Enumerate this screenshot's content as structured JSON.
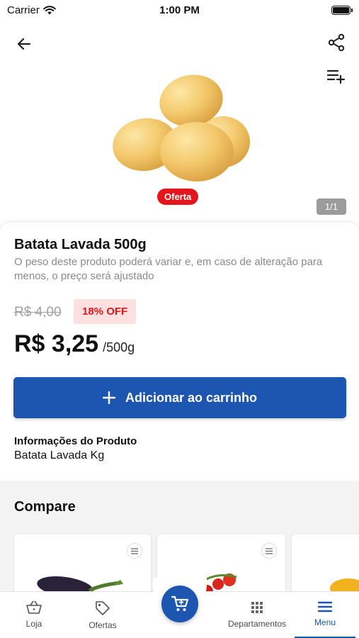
{
  "status_bar": {
    "carrier": "Carrier",
    "time": "1:00 PM"
  },
  "header": {
    "back_icon": "arrow-left-icon",
    "share_icon": "share-icon",
    "add_to_list_icon": "playlist-add-icon"
  },
  "image_gallery": {
    "offer_badge": "Oferta",
    "counter": "1/1"
  },
  "product": {
    "title": "Batata Lavada 500g",
    "note": "O peso deste produto poderá variar e, em caso de alteração para menos, o preço será ajustado",
    "old_price": "R$ 4,00",
    "discount": "18% OFF",
    "price": "R$ 3,25",
    "unit": "/500g",
    "add_button_label": "Adicionar ao carrinho"
  },
  "info": {
    "title": "Informações do Produto",
    "value": "Batata Lavada Kg"
  },
  "compare": {
    "title": "Compare"
  },
  "bottom_nav": {
    "items": [
      {
        "label": "Loja",
        "icon": "basket-icon"
      },
      {
        "label": "Ofertas",
        "icon": "tag-icon"
      },
      {
        "label": "Departamentos",
        "icon": "grid-icon"
      },
      {
        "label": "Menu",
        "icon": "menu-icon",
        "active": true
      }
    ],
    "cart_icon": "cart-icon"
  },
  "colors": {
    "primary": "#1c56b0",
    "offer_red": "#e4161b",
    "discount_bg": "#fde0df"
  }
}
